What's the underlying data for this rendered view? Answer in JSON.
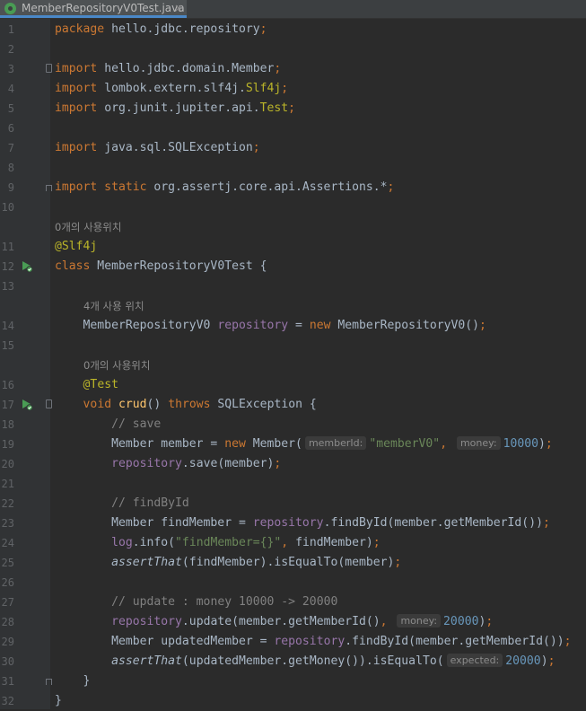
{
  "tab": {
    "title": "MemberRepositoryV0Test.java",
    "close": "×"
  },
  "lines": [
    {
      "n": "1",
      "tokens": [
        [
          "kw",
          "package"
        ],
        [
          "",
          "  hello.jdbc.repository"
        ],
        [
          "kw",
          ";"
        ]
      ]
    },
    {
      "n": "2",
      "tokens": []
    },
    {
      "n": "3",
      "fold": "start",
      "tokens": [
        [
          "kw",
          "import"
        ],
        [
          "",
          "  hello.jdbc.domain.Member"
        ],
        [
          "kw",
          ";"
        ]
      ]
    },
    {
      "n": "4",
      "tokens": [
        [
          "kw",
          "import"
        ],
        [
          "",
          "  lombok.extern.slf4j."
        ],
        [
          "ann",
          "Slf4j"
        ],
        [
          "kw",
          ";"
        ]
      ]
    },
    {
      "n": "5",
      "tokens": [
        [
          "kw",
          "import"
        ],
        [
          "",
          "  org.junit.jupiter.api."
        ],
        [
          "ann",
          "Test"
        ],
        [
          "kw",
          ";"
        ]
      ]
    },
    {
      "n": "6",
      "tokens": []
    },
    {
      "n": "7",
      "tokens": [
        [
          "kw",
          "import"
        ],
        [
          "",
          "  java.sql.SQLException"
        ],
        [
          "kw",
          ";"
        ]
      ]
    },
    {
      "n": "8",
      "tokens": []
    },
    {
      "n": "9",
      "fold": "end",
      "tokens": [
        [
          "kw",
          "import static"
        ],
        [
          "",
          "  org.assertj.core.api.Assertions.*"
        ],
        [
          "kw",
          ";"
        ]
      ]
    },
    {
      "n": "10",
      "tokens": []
    },
    {
      "hint": "0개의 사용위치",
      "indent": 0
    },
    {
      "n": "11",
      "tokens": [
        [
          "ann",
          "@Slf4j"
        ]
      ]
    },
    {
      "n": "12",
      "run": true,
      "tokens": [
        [
          "kw",
          "class"
        ],
        [
          "",
          " MemberRepositoryV0Test {"
        ]
      ]
    },
    {
      "n": "13",
      "tokens": []
    },
    {
      "hint": "4개 사용 위치",
      "indent": 1
    },
    {
      "n": "14",
      "tokens": [
        [
          "",
          "    MemberRepositoryV0 "
        ],
        [
          "fld",
          "repository"
        ],
        [
          "",
          " = "
        ],
        [
          "kw",
          "new"
        ],
        [
          "",
          " MemberRepositoryV0()"
        ],
        [
          "kw",
          ";"
        ]
      ]
    },
    {
      "n": "15",
      "tokens": []
    },
    {
      "hint": "0개의 사용위치",
      "indent": 1
    },
    {
      "n": "16",
      "tokens": [
        [
          "",
          "    "
        ],
        [
          "ann",
          "@Test"
        ]
      ]
    },
    {
      "n": "17",
      "run": true,
      "fold": "start",
      "tokens": [
        [
          "",
          "    "
        ],
        [
          "kw",
          "void"
        ],
        [
          "",
          " "
        ],
        [
          "fn",
          "crud"
        ],
        [
          "",
          "() "
        ],
        [
          "kw",
          "throws"
        ],
        [
          "",
          " SQLException {"
        ]
      ]
    },
    {
      "n": "18",
      "tokens": [
        [
          "",
          "        "
        ],
        [
          "cmt",
          "// save"
        ]
      ]
    },
    {
      "n": "19",
      "tokens": [
        [
          "",
          "        Member member = "
        ],
        [
          "kw",
          "new"
        ],
        [
          "",
          " Member("
        ],
        [
          "ph",
          "memberId:"
        ],
        [
          "str",
          "\"memberV0\""
        ],
        [
          "kw",
          ","
        ],
        [
          "",
          " "
        ],
        [
          "ph",
          "money:"
        ],
        [
          "num",
          "10000"
        ],
        [
          "",
          ")"
        ],
        [
          "kw",
          ";"
        ]
      ]
    },
    {
      "n": "20",
      "tokens": [
        [
          "",
          "        "
        ],
        [
          "fld",
          "repository"
        ],
        [
          "",
          ".save(member)"
        ],
        [
          "kw",
          ";"
        ]
      ]
    },
    {
      "n": "21",
      "tokens": []
    },
    {
      "n": "22",
      "tokens": [
        [
          "",
          "        "
        ],
        [
          "cmt",
          "// findById"
        ]
      ]
    },
    {
      "n": "23",
      "tokens": [
        [
          "",
          "        Member findMember = "
        ],
        [
          "fld",
          "repository"
        ],
        [
          "",
          ".findById(member.getMemberId())"
        ],
        [
          "kw",
          ";"
        ]
      ]
    },
    {
      "n": "24",
      "tokens": [
        [
          "",
          "        "
        ],
        [
          "fld",
          "log"
        ],
        [
          "",
          ".info("
        ],
        [
          "str",
          "\"findMember={}\""
        ],
        [
          "kw",
          ","
        ],
        [
          "",
          " findMember)"
        ],
        [
          "kw",
          ";"
        ]
      ]
    },
    {
      "n": "25",
      "tokens": [
        [
          "",
          "        "
        ],
        [
          "it",
          "assertThat"
        ],
        [
          "",
          "(findMember).isEqualTo(member)"
        ],
        [
          "kw",
          ";"
        ]
      ]
    },
    {
      "n": "26",
      "tokens": []
    },
    {
      "n": "27",
      "tokens": [
        [
          "",
          "        "
        ],
        [
          "cmt",
          "// update : money 10000 -> 20000"
        ]
      ]
    },
    {
      "n": "28",
      "tokens": [
        [
          "",
          "        "
        ],
        [
          "fld",
          "repository"
        ],
        [
          "",
          ".update(member.getMemberId()"
        ],
        [
          "kw",
          ","
        ],
        [
          "",
          " "
        ],
        [
          "ph",
          "money:"
        ],
        [
          "num",
          "20000"
        ],
        [
          "",
          ")"
        ],
        [
          "kw",
          ";"
        ]
      ]
    },
    {
      "n": "29",
      "tokens": [
        [
          "",
          "        Member updatedMember = "
        ],
        [
          "fld",
          "repository"
        ],
        [
          "",
          ".findById(member.getMemberId())"
        ],
        [
          "kw",
          ";"
        ]
      ]
    },
    {
      "n": "30",
      "tokens": [
        [
          "",
          "        "
        ],
        [
          "it",
          "assertThat"
        ],
        [
          "",
          "(updatedMember.getMoney()).isEqualTo("
        ],
        [
          "ph",
          "expected:"
        ],
        [
          "num",
          "20000"
        ],
        [
          "",
          ")"
        ],
        [
          "kw",
          ";"
        ]
      ]
    },
    {
      "n": "31",
      "fold": "end",
      "tokens": [
        [
          "",
          "    }"
        ]
      ]
    },
    {
      "n": "32",
      "tokens": [
        [
          "",
          "}"
        ]
      ]
    }
  ]
}
